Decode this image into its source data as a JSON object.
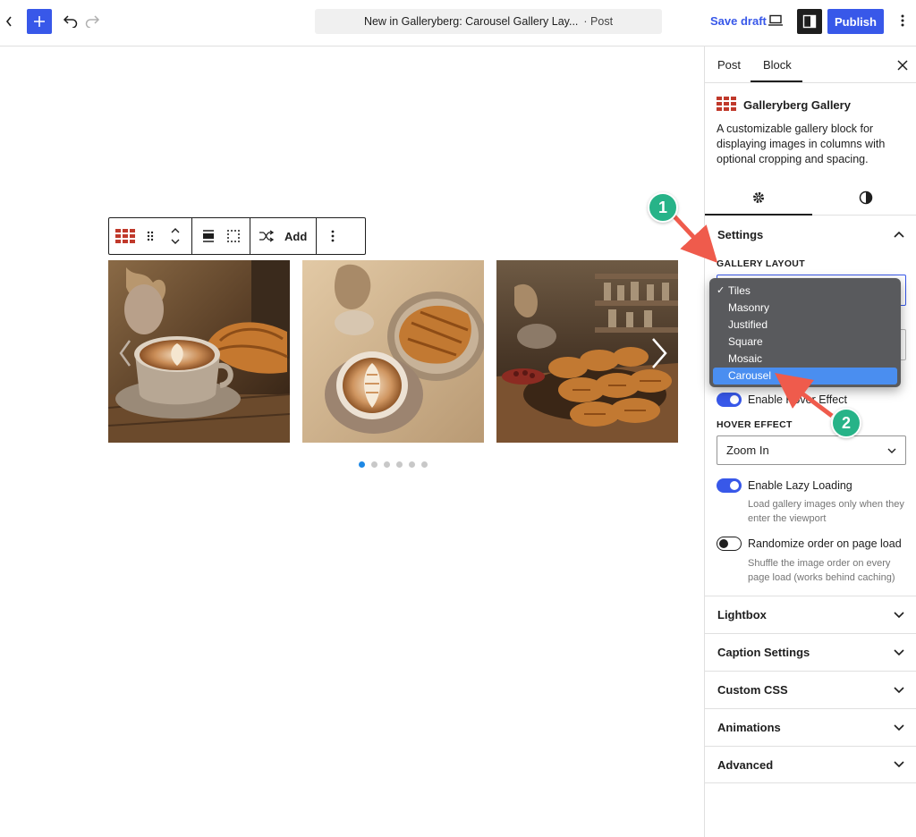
{
  "topbar": {
    "doc_title": "New in Galleryberg: Carousel Gallery Lay...",
    "doc_type": "· Post",
    "save_draft": "Save draft",
    "publish": "Publish"
  },
  "canvas": {
    "toolbar_add": "Add",
    "photos": [
      "latte-and-croissant-photo",
      "latte-and-croissant-topdown-photo",
      "pastry-display-photo"
    ],
    "dots_count": 6,
    "active_dot": 0
  },
  "sidebar": {
    "tabs": {
      "post": "Post",
      "block": "Block"
    },
    "block_name": "Galleryberg Gallery",
    "block_desc": "A customizable gallery block for displaying images in columns with optional cropping and spacing.",
    "settings_title": "Settings",
    "gallery_layout_label": "GALLERY LAYOUT",
    "layout_options": [
      "Tiles",
      "Masonry",
      "Justified",
      "Square",
      "Mosaic",
      "Carousel"
    ],
    "enable_hover_label": "Enable Hover Effect",
    "hover_effect_label": "HOVER EFFECT",
    "hover_effect_value": "Zoom In",
    "lazy_label": "Enable Lazy Loading",
    "lazy_help": "Load gallery images only when they enter the viewport",
    "randomize_label": "Randomize order on page load",
    "randomize_help": "Shuffle the image order on every page load (works behind caching)",
    "panels": [
      "Lightbox",
      "Caption Settings",
      "Custom CSS",
      "Animations",
      "Advanced"
    ]
  },
  "annotations": {
    "badge1": "1",
    "badge2": "2"
  },
  "colors": {
    "accent": "#3858e9",
    "block_icon": "#c0392b",
    "badge": "#27b388",
    "arrow": "#ef5b4c"
  }
}
